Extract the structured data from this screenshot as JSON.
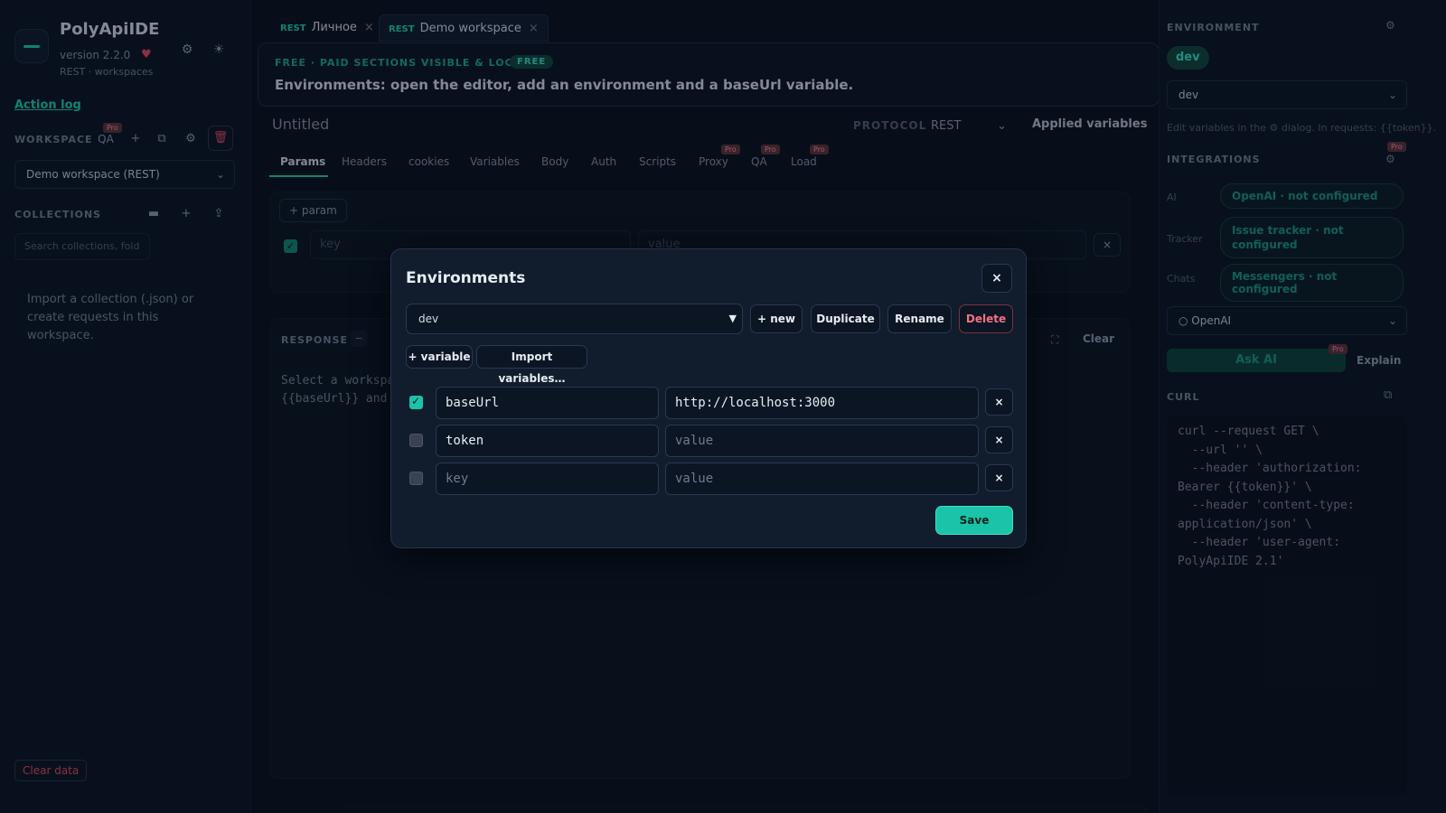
{
  "app": {
    "name": "PolyApiIDE",
    "version": "version 2.2.0",
    "subtitle": "REST · workspaces",
    "action_log": "Action log",
    "clear_data": "Clear data"
  },
  "sidebar": {
    "workspace_label": "WORKSPACE",
    "qa_label": "QA",
    "pro_tag": "Pro",
    "workspace_select": "Demo workspace (REST)",
    "collections_label": "COLLECTIONS",
    "search_placeholder": "Search collections, fold",
    "empty_text": "Import a collection (.json) or create requests in this workspace."
  },
  "tabs": [
    {
      "protocol": "REST",
      "label": "Личное"
    },
    {
      "protocol": "REST",
      "label": "Demo workspace"
    }
  ],
  "banner": {
    "top": "FREE · PAID SECTIONS VISIBLE & LOCKED",
    "badge": "FREE",
    "main": "Environments: open the editor, add an environment and a baseUrl variable."
  },
  "request": {
    "title": "Untitled",
    "protocol_label": "PROTOCOL",
    "protocol_value": "REST",
    "applied_variables": "Applied variables",
    "tabs": [
      "Params",
      "Headers",
      "cookies",
      "Variables",
      "Body",
      "Auth",
      "Scripts",
      "Proxy",
      "QA",
      "Load"
    ],
    "pro_tag": "Pro",
    "add_param": "+ param",
    "param_key_placeholder": "key",
    "param_value_placeholder": "value"
  },
  "response": {
    "label": "RESPONSE",
    "text_line1": "Select a workspa",
    "text_line2": "{{baseUrl}} and",
    "clear": "Clear"
  },
  "right": {
    "environment_label": "ENVIRONMENT",
    "env_pill": "dev",
    "env_select": "dev",
    "env_hint": "Edit variables in the ⚙ dialog. In requests: {{token}}.",
    "integrations_label": "INTEGRATIONS",
    "pro_tag": "Pro",
    "integrations": [
      {
        "label": "AI",
        "value": "OpenAI · not configured"
      },
      {
        "label": "Tracker",
        "value": "Issue tracker · not configured"
      },
      {
        "label": "Chats",
        "value": "Messengers · not configured"
      }
    ],
    "ai_select": "○ OpenAI",
    "ask_ai": "Ask AI",
    "explain": "Explain",
    "curl_label": "CURL",
    "curl_text": "curl --request GET \\\n  --url '' \\\n  --header 'authorization: Bearer {{token}}' \\\n  --header 'content-type: application/json' \\\n  --header 'user-agent: PolyApiIDE 2.1'"
  },
  "modal": {
    "title": "Environments",
    "close": "×",
    "env_select": "dev",
    "buttons": {
      "new": "+ new",
      "duplicate": "Duplicate",
      "rename": "Rename",
      "delete": "Delete",
      "add_variable": "+ variable",
      "import_variables": "Import variables…",
      "save": "Save"
    },
    "variables": [
      {
        "enabled": true,
        "key": "baseUrl",
        "key_placeholder": "key",
        "value": "http://localhost:3000",
        "value_placeholder": "value"
      },
      {
        "enabled": false,
        "key": "token",
        "key_placeholder": "key",
        "value": "",
        "value_placeholder": "value"
      },
      {
        "enabled": false,
        "key": "",
        "key_placeholder": "key",
        "value": "",
        "value_placeholder": "value"
      }
    ],
    "delete_row": "×"
  },
  "colors": {
    "accent": "#1bc3a8",
    "danger": "#f07186",
    "background": "#0a1220"
  }
}
